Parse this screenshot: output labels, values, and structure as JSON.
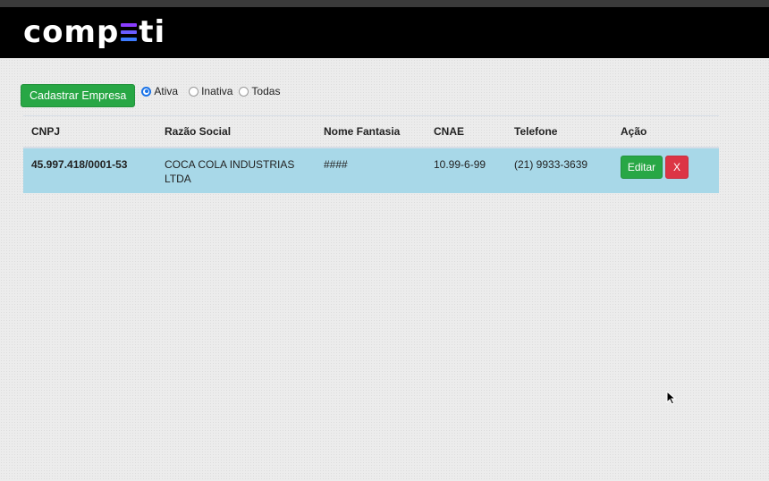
{
  "header": {
    "logo_left": "comp",
    "logo_right": "ti"
  },
  "toolbar": {
    "add_button": "Cadastrar Empresa",
    "filters": [
      {
        "label": "Ativa",
        "checked": true
      },
      {
        "label": "Inativa",
        "checked": false
      },
      {
        "label": "Todas",
        "checked": false
      }
    ]
  },
  "table": {
    "columns": [
      "CNPJ",
      "Razão Social",
      "Nome Fantasia",
      "CNAE",
      "Telefone",
      "Ação"
    ],
    "rows": [
      {
        "cnpj": "45.997.418/0001-53",
        "razao_social": "COCA COLA INDUSTRIAS LTDA",
        "nome_fantasia": "####",
        "cnae": "10.99-6-99",
        "telefone": "(21) 9933-3639",
        "edit_label": "Editar",
        "delete_label": "X"
      }
    ]
  },
  "colors": {
    "navbar": "#000000",
    "accent_green": "#28a745",
    "accent_red": "#dc3545",
    "row_highlight": "#a8d8e8"
  }
}
